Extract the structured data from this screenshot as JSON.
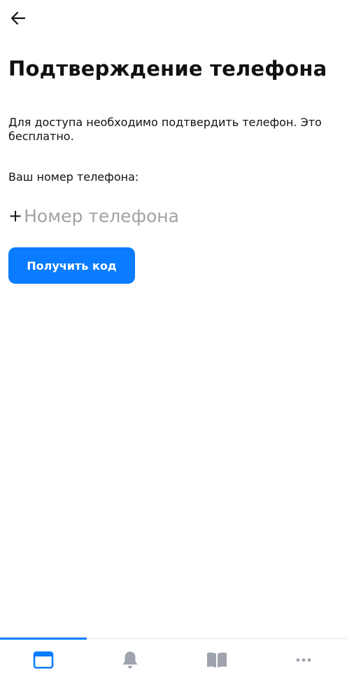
{
  "header": {
    "back_icon": "arrow-left-icon"
  },
  "main": {
    "title": "Подтверждение телефона",
    "description": "Для доступа необходимо подтвердить телефон. Это бесплатно.",
    "phone_label": "Ваш номер телефона:",
    "phone_prefix": "+",
    "phone_placeholder": "Номер телефона",
    "phone_value": "",
    "get_code_button": "Получить код"
  },
  "tabbar": {
    "active_index": 0,
    "tabs": [
      {
        "icon": "window-icon",
        "active": true
      },
      {
        "icon": "bell-icon",
        "active": false
      },
      {
        "icon": "book-icon",
        "active": false
      },
      {
        "icon": "more-icon",
        "active": false
      }
    ]
  },
  "colors": {
    "accent": "#0a7cff",
    "text": "#111111",
    "placeholder": "#a2a2a6",
    "inactive_icon": "#9ea3ad"
  }
}
